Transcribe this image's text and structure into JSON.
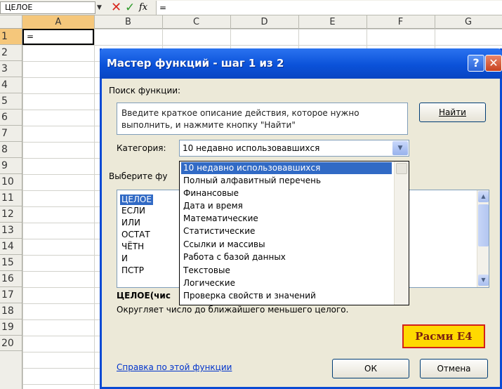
{
  "formula_bar": {
    "name_box": "ЦЕЛОЕ",
    "name_box_arrow_icon": "triangle-down",
    "cancel_icon": "✕",
    "enter_icon": "✓",
    "fx_icon": "fx",
    "formula": "="
  },
  "columns": [
    "A",
    "B",
    "C",
    "D",
    "E",
    "F",
    "G"
  ],
  "rows": [
    "1",
    "2",
    "3",
    "4",
    "5",
    "6",
    "7",
    "8",
    "9",
    "10",
    "11",
    "12",
    "13",
    "14",
    "15",
    "16",
    "17",
    "18",
    "19",
    "20"
  ],
  "cell_a1": "=",
  "dialog": {
    "title": "Мастер функций - шаг 1 из 2",
    "help_label": "?",
    "close_label": "✕",
    "search_label": "Поиск функции:",
    "search_text": "Введите краткое описание действия, которое нужно выполнить, и нажмите кнопку \"Найти\"",
    "find_button": "Найти",
    "category_label": "Категория:",
    "category_value": "10 недавно использовавшихся",
    "select_function_label": "Выберите фу",
    "functions": [
      "ЦЕЛОЕ",
      "ЕСЛИ",
      "ИЛИ",
      "ОСТАТ",
      "ЧЁТН",
      "И",
      "ПСТР"
    ],
    "function_signature": "ЦЕЛОЕ(чис",
    "function_description": "Округляет число до ближайшего меньшего целого.",
    "help_link": "Справка по этой функции",
    "ok_button": "ОК",
    "cancel_button": "Отмена"
  },
  "category_dropdown": {
    "options": [
      "10 недавно использовавшихся",
      "Полный алфавитный перечень",
      "Финансовые",
      "Дата и время",
      "Математические",
      "Статистические",
      "Ссылки и массивы",
      "Работа с базой данных",
      "Текстовые",
      "Логические",
      "Проверка свойств и значений"
    ],
    "selected": "10 недавно использовавшихся"
  },
  "caption": "Расми Е4",
  "colors": {
    "title_bar": "#0b52d9",
    "selection": "#316ac5",
    "dialog_bg": "#ece9d8",
    "caption_bg": "#ffd900",
    "caption_border": "#d4201a"
  }
}
